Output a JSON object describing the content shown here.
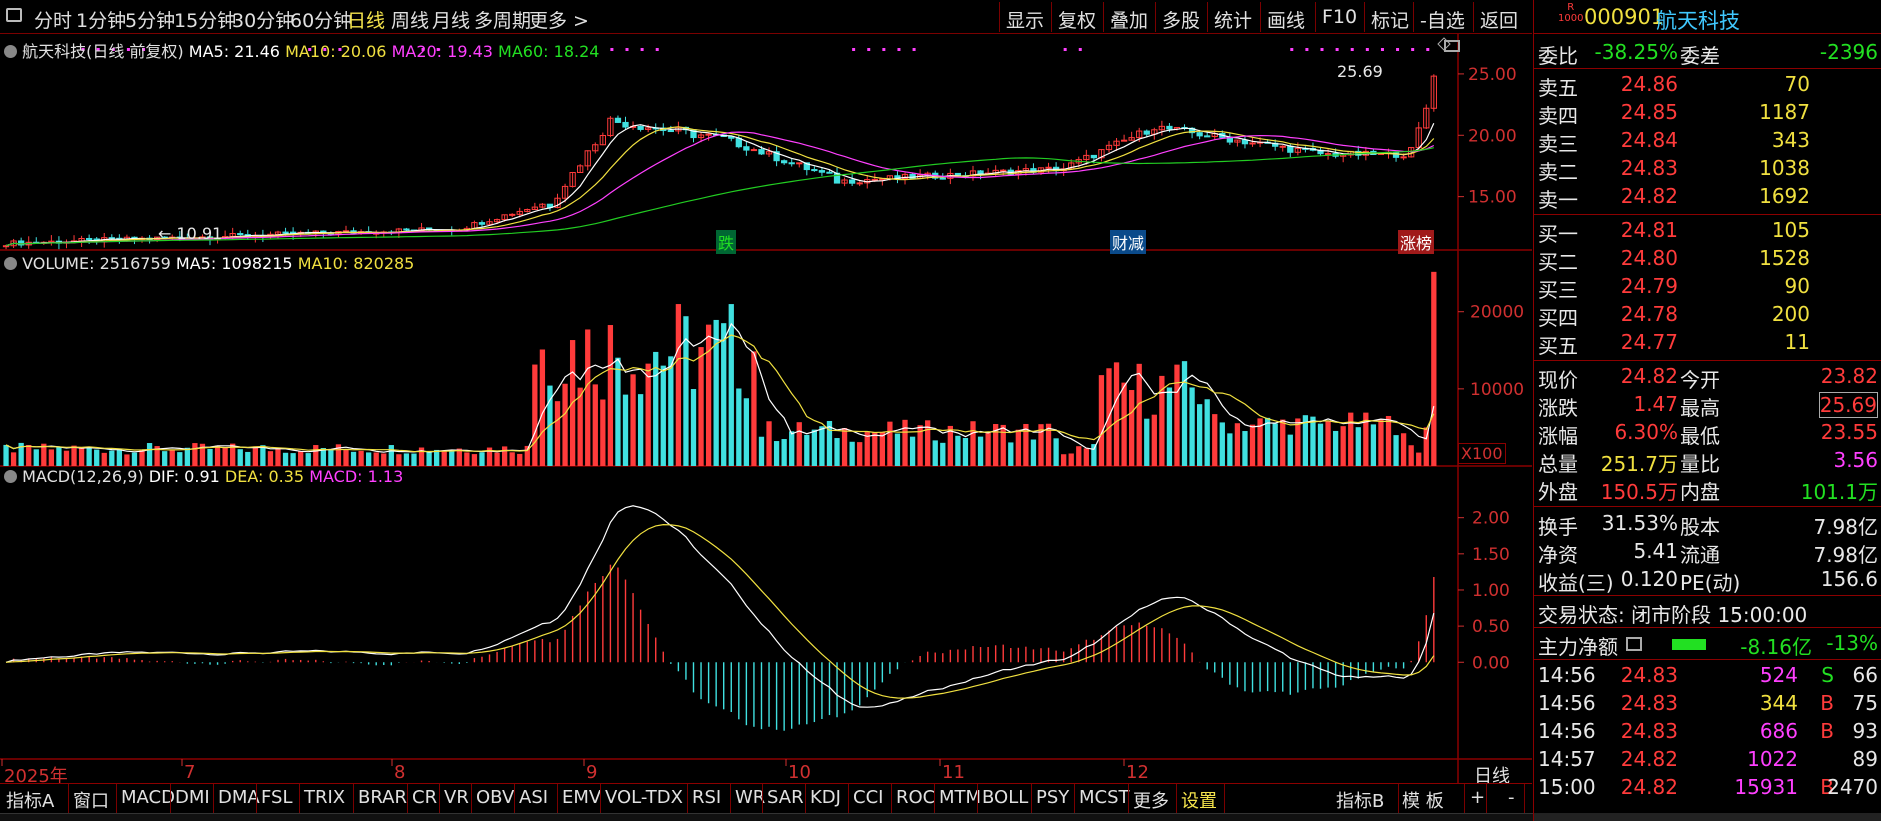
{
  "topbar": {
    "period_tabs": [
      "分时",
      "1分钟",
      "5分钟",
      "15分钟",
      "30分钟",
      "60分钟",
      "日线",
      "周线",
      "月线",
      "多周期",
      "更多 >"
    ],
    "selected": "日线",
    "tools": [
      "显示",
      "复权",
      "叠加",
      "多股",
      "统计",
      "画线",
      "F10",
      "标记",
      "-自选",
      "返回"
    ]
  },
  "stock": {
    "code": "000901",
    "name": "航天科技",
    "badge_top": "R",
    "badge_bottom": "1000"
  },
  "price_panel": {
    "title": "航天科技(日线 前复权)",
    "ma5": "MA5: 21.46",
    "ma10": "MA10: 20.06",
    "ma20": "MA20: 19.43",
    "ma60": "MA60: 18.24",
    "y_ticks": [
      "25.00",
      "20.00",
      "15.00"
    ],
    "high_label": "25.69",
    "low_label": "10.91",
    "tags": [
      "跌",
      "财减",
      "涨榜"
    ]
  },
  "volume_panel": {
    "title": "VOLUME: 2516759",
    "ma5": "MA5: 1098215",
    "ma10": "MA10: 820285",
    "y_ticks": [
      "20000",
      "10000"
    ],
    "unit": "X100"
  },
  "macd_panel": {
    "title": "MACD(12,26,9)",
    "dif": "DIF: 0.91",
    "dea": "DEA: 0.35",
    "macd": "MACD: 1.13",
    "y_ticks": [
      "2.00",
      "1.50",
      "1.00",
      "0.50",
      "0.00"
    ]
  },
  "x_axis": {
    "labels": [
      "2025年",
      "7",
      "8",
      "9",
      "10",
      "11",
      "12"
    ],
    "period": "日线"
  },
  "order_book": {
    "weibi_label": "委比",
    "weibi": "-38.25%",
    "weicha_label": "委差",
    "weicha": "-2396",
    "asks": [
      {
        "label": "卖五",
        "price": "24.86",
        "vol": "70"
      },
      {
        "label": "卖四",
        "price": "24.85",
        "vol": "1187"
      },
      {
        "label": "卖三",
        "price": "24.84",
        "vol": "343"
      },
      {
        "label": "卖二",
        "price": "24.83",
        "vol": "1038"
      },
      {
        "label": "卖一",
        "price": "24.82",
        "vol": "1692"
      }
    ],
    "bids": [
      {
        "label": "买一",
        "price": "24.81",
        "vol": "105"
      },
      {
        "label": "买二",
        "price": "24.80",
        "vol": "1528"
      },
      {
        "label": "买三",
        "price": "24.79",
        "vol": "90"
      },
      {
        "label": "买四",
        "price": "24.78",
        "vol": "200"
      },
      {
        "label": "买五",
        "price": "24.77",
        "vol": "11"
      }
    ]
  },
  "quote": [
    {
      "l1": "现价",
      "v1": "24.82",
      "l2": "今开",
      "v2": "23.82"
    },
    {
      "l1": "涨跌",
      "v1": "1.47",
      "l2": "最高",
      "v2": "25.69"
    },
    {
      "l1": "涨幅",
      "v1": "6.30%",
      "l2": "最低",
      "v2": "23.55"
    },
    {
      "l1": "总量",
      "v1": "251.7万",
      "l2": "量比",
      "v2": "3.56"
    },
    {
      "l1": "外盘",
      "v1": "150.5万",
      "l2": "内盘",
      "v2": "101.1万"
    },
    {
      "l1": "换手",
      "v1": "31.53%",
      "l2": "股本",
      "v2": "7.98亿"
    },
    {
      "l1": "净资",
      "v1": "5.41",
      "l2": "流通",
      "v2": "7.98亿"
    },
    {
      "l1": "收益(三)",
      "v1": "0.120",
      "l2": "PE(动)",
      "v2": "156.6"
    }
  ],
  "trade_status": "交易状态: 闭市阶段 15:00:00",
  "main_flow": {
    "label": "主力净额",
    "value": "-8.16亿",
    "pct": "-13%"
  },
  "ticks": [
    {
      "time": "14:56",
      "price": "24.83",
      "vol": "524",
      "side": "S",
      "n": "66"
    },
    {
      "time": "14:56",
      "price": "24.83",
      "vol": "344",
      "side": "B",
      "n": "75"
    },
    {
      "time": "14:56",
      "price": "24.83",
      "vol": "686",
      "side": "B",
      "n": "93"
    },
    {
      "time": "14:57",
      "price": "24.82",
      "vol": "1022",
      "side": "",
      "n": "89"
    },
    {
      "time": "15:00",
      "price": "24.82",
      "vol": "15931",
      "side": "B",
      "n": "2470"
    }
  ],
  "bottom_tabs": [
    "指标A",
    "窗口",
    "MACD",
    "DMI",
    "DMA",
    "FSL",
    "TRIX",
    "BRAR",
    "CR",
    "VR",
    "OBV",
    "ASI",
    "EMV",
    "VOL-TDX",
    "RSI",
    "WR",
    "SAR",
    "KDJ",
    "CCI",
    "ROC",
    "MTM",
    "BOLL",
    "PSY",
    "MCST",
    "更多",
    "设置",
    "指标B",
    "模 板",
    "+",
    "-"
  ],
  "colors": {
    "up": "#ff3b3b",
    "down": "#40e0e0",
    "ma5": "#ffffff",
    "ma10": "#f0e040",
    "ma20": "#ff40ff",
    "ma60": "#22cc22",
    "grid": "#8b0000"
  },
  "chart_data": [
    {
      "type": "candlestick",
      "title": "航天科技(日线 前复权)",
      "series": [
        {
          "name": "MA5",
          "last": 21.46
        },
        {
          "name": "MA10",
          "last": 20.06
        },
        {
          "name": "MA20",
          "last": 19.43
        },
        {
          "name": "MA60",
          "last": 18.24
        }
      ],
      "ylim": [
        10,
        27
      ],
      "high": 25.69,
      "low": 10.91
    },
    {
      "type": "bar",
      "title": "VOLUME",
      "ylim": [
        0,
        28000
      ],
      "last": 25168,
      "series": [
        {
          "name": "MA5",
          "last": 10982
        },
        {
          "name": "MA10",
          "last": 8203
        }
      ]
    },
    {
      "type": "bar",
      "title": "MACD(12,26,9)",
      "ylim": [
        -1.2,
        2.3
      ],
      "series": [
        {
          "name": "DIF",
          "last": 0.91
        },
        {
          "name": "DEA",
          "last": 0.35
        },
        {
          "name": "MACD",
          "last": 1.13
        }
      ]
    }
  ]
}
